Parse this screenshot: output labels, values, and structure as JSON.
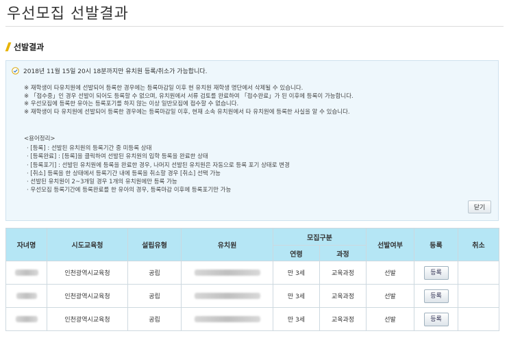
{
  "page": {
    "title": "우선모집 선발결과"
  },
  "section": {
    "title": "선발결과"
  },
  "notice": {
    "text": "2018년 11월 15일 20시 18분까지만 유치원 등록/취소가 가능합니다.",
    "rules": [
      "※ 재학생이 타유치원에 선발되어 등록한 경우에는 등록마감일 이후 현 유치원 재학생 명단에서 삭제될 수 있습니다.",
      "※ 「접수중」인 경우 선발이 되어도 등록할 수 없으며, 유치원에서 서류 검토를 완료하여 「접수완료」가 된 이후에 등록이 가능합니다.",
      "※ 우선모집에 등록한 유아는 등록포기를 하지 않는 이상 일반모집에 접수할 수 없습니다.",
      "※ 재학생이 타 유치원에 선발되어 등록한 경우에는 등록마감일 이후, 현재 소속 유치원에서 타 유치원에 등록한 사실을 알 수 있습니다."
    ],
    "glossary_title": "<용어정리>",
    "glossary": [
      "· [등록] : 선발된 유치원의 등록기간 중 미등록 상태",
      "· [등록완료] : [등록]을 클릭하여 선발된 유치원의 입학 등록을 완료한 상태",
      "· [등록포기] : 선발된 유치원에 등록을 완료한 경우, 나머지 선발된 유치원은 자동으로 등록 포기 상태로 변경",
      "· [취소] 등록을 한 상태에서 등록기간 내에 등록을 취소할 경우 [취소] 선택 가능",
      "· 선발된 유치원이 2~3개일 경우 1개의 유치원에만 등록 가능",
      "· 우선모집 등록기간에 등록완료를 한 유아의 경우, 등록마감 이후에 등록포기만 가능"
    ],
    "close_label": "닫기"
  },
  "table": {
    "headers": {
      "child_name": "자녀명",
      "office": "시도교육청",
      "type": "설립유형",
      "kindergarten": "유치원",
      "recruit_group": "모집구분",
      "age": "연령",
      "course": "과정",
      "selection": "선발여부",
      "register": "등록",
      "cancel": "취소"
    },
    "rows": [
      {
        "office": "인천광역시교육청",
        "type": "공립",
        "age": "만 3세",
        "course": "교육과정",
        "selection": "선발",
        "register_label": "등록"
      },
      {
        "office": "인천광역시교육청",
        "type": "공립",
        "age": "만 3세",
        "course": "교육과정",
        "selection": "선발",
        "register_label": "등록"
      },
      {
        "office": "인천광역시교육청",
        "type": "공립",
        "age": "만 3세",
        "course": "교육과정",
        "selection": "선발",
        "register_label": "등록"
      }
    ]
  },
  "colors": {
    "header_bg": "#b5e6f5",
    "info_bg": "#eef7fc",
    "accent": "#e8b400",
    "selected_text": "#3c8a3c"
  }
}
